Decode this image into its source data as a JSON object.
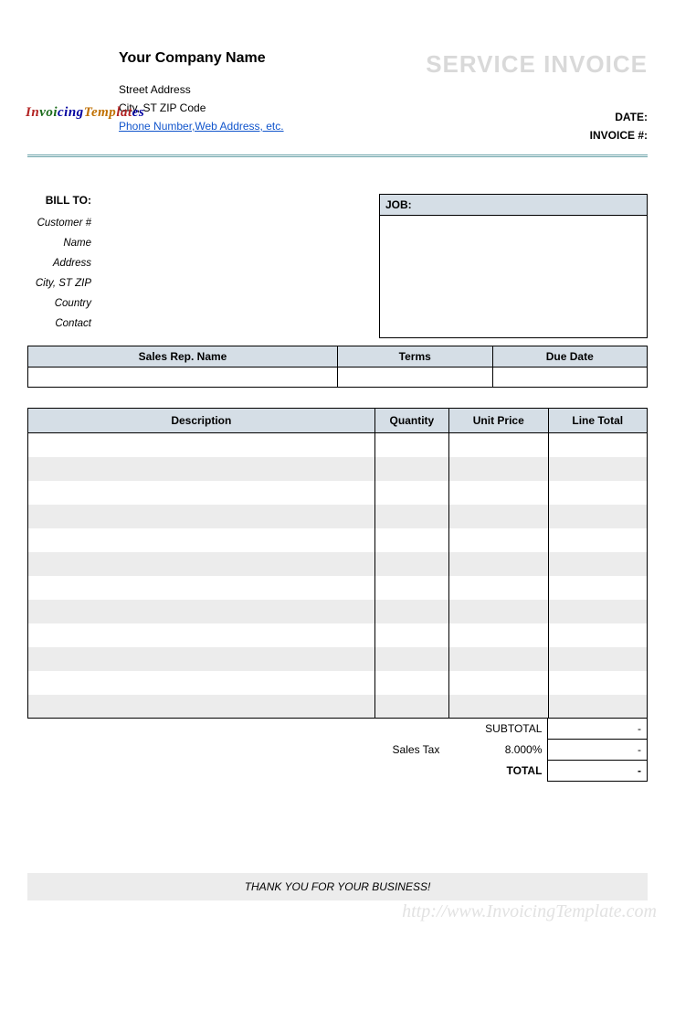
{
  "header": {
    "company_name": "Your Company Name",
    "street": "Street Address",
    "city_line": "City, ST  ZIP Code",
    "contact_link": "Phone Number,Web Address, etc.",
    "invoice_title": "SERVICE INVOICE",
    "date_label": "DATE:",
    "date_value": "",
    "invoice_no_label": "INVOICE #:",
    "invoice_no_value": ""
  },
  "bill_to": {
    "title": "BILL TO:",
    "fields": [
      {
        "label": "Customer #",
        "value": ""
      },
      {
        "label": "Name",
        "value": ""
      },
      {
        "label": "Address",
        "value": ""
      },
      {
        "label": "City, ST ZIP",
        "value": ""
      },
      {
        "label": "Country",
        "value": ""
      },
      {
        "label": "Contact",
        "value": ""
      }
    ]
  },
  "job": {
    "label": "JOB:",
    "value": ""
  },
  "meta": {
    "headers": [
      "Sales Rep. Name",
      "Terms",
      "Due Date"
    ],
    "values": [
      "",
      "",
      ""
    ]
  },
  "items": {
    "headers": [
      "Description",
      "Quantity",
      "Unit Price",
      "Line Total"
    ],
    "rows": [
      [
        "",
        "",
        "",
        ""
      ],
      [
        "",
        "",
        "",
        ""
      ],
      [
        "",
        "",
        "",
        ""
      ],
      [
        "",
        "",
        "",
        ""
      ],
      [
        "",
        "",
        "",
        ""
      ],
      [
        "",
        "",
        "",
        ""
      ],
      [
        "",
        "",
        "",
        ""
      ],
      [
        "",
        "",
        "",
        ""
      ],
      [
        "",
        "",
        "",
        ""
      ],
      [
        "",
        "",
        "",
        ""
      ],
      [
        "",
        "",
        "",
        ""
      ],
      [
        "",
        "",
        "",
        ""
      ]
    ]
  },
  "totals": {
    "subtotal_label": "SUBTOTAL",
    "subtotal_value": "-",
    "sales_tax_label": "Sales Tax",
    "sales_tax_rate": "8.000%",
    "sales_tax_value": "-",
    "total_label": "TOTAL",
    "total_value": "-"
  },
  "footer": {
    "thanks": "THANK YOU FOR YOUR BUSINESS!",
    "watermark": "http://www.InvoicingTemplate.com"
  },
  "logo": {
    "text": "InvoicingTemplates"
  }
}
